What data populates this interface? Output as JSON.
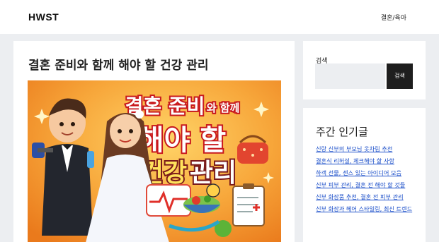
{
  "site": {
    "logo": "HWST",
    "nav": [
      "결혼/육아"
    ]
  },
  "post": {
    "title": "결혼 준비와 함께 해야 할 건강 관리",
    "image": {
      "line1a": "결혼 준비",
      "line1b": "와 함께",
      "line2": "해야 할",
      "line3a": "건강",
      "line3b": "관리"
    }
  },
  "sidebar": {
    "search": {
      "label": "검색",
      "button": "검색",
      "placeholder": ""
    },
    "popular": {
      "title": "주간 인기글",
      "items": [
        "신랑 신부의 부모님 옷차림 추천",
        "결혼식 리허설, 체크해야 할 사항",
        "하객 선물, 센스 있는 아이디어 모음",
        "신부 피부 관리, 결혼 전 해야 할 것들",
        "신부 화장품 추천, 결혼 전 피부 관리",
        "신부 화장과 헤어 스타일링, 최신 트렌드"
      ]
    }
  },
  "colors": {
    "accent_link": "#1a4ec9",
    "button_bg": "#1e1e1e",
    "image_bg": "#f39a2c",
    "headline_fill": "#ffffff",
    "headline_stroke": "#c8181d"
  }
}
